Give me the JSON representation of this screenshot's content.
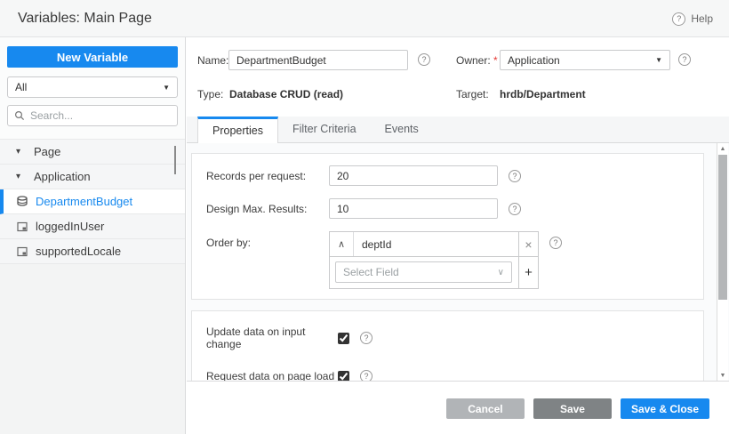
{
  "header": {
    "title": "Variables: Main Page",
    "help_label": "Help"
  },
  "sidebar": {
    "new_variable_label": "New Variable",
    "filter_value": "All",
    "search_placeholder": "Search...",
    "tree": [
      {
        "label": "Page",
        "type": "group",
        "expanded": true
      },
      {
        "label": "Application",
        "type": "group",
        "expanded": true
      },
      {
        "label": "DepartmentBudget",
        "type": "variable",
        "icon": "database-crud-variable-icon",
        "selected": true
      },
      {
        "label": "loggedInUser",
        "type": "variable",
        "icon": "static-variable-icon",
        "selected": false
      },
      {
        "label": "supportedLocale",
        "type": "variable",
        "icon": "static-variable-icon",
        "selected": false
      }
    ]
  },
  "form": {
    "name_label": "Name:",
    "name_value": "DepartmentBudget",
    "owner_label": "Owner:",
    "owner_value": "Application",
    "type_label": "Type:",
    "type_value": "Database CRUD (read)",
    "target_label": "Target:",
    "target_value": "hrdb/Department",
    "required_marker": "*"
  },
  "tabs": [
    {
      "label": "Properties",
      "active": true
    },
    {
      "label": "Filter Criteria",
      "active": false
    },
    {
      "label": "Events",
      "active": false
    }
  ],
  "properties": {
    "records_label": "Records per request:",
    "records_value": "20",
    "design_max_label": "Design Max. Results:",
    "design_max_value": "10",
    "order_by_label": "Order by:",
    "order_by_field": "deptId",
    "select_field_placeholder": "Select Field",
    "update_data_label": "Update data on input change",
    "update_data_checked": true,
    "request_data_label": "Request data on page load",
    "request_data_checked": true
  },
  "footer": {
    "cancel_label": "Cancel",
    "save_label": "Save",
    "save_close_label": "Save & Close"
  },
  "icons": {
    "question_mark": "?",
    "caret_down": "▼",
    "tree_caret": "▾",
    "chevron_up": "∧",
    "chevron_down": "∨",
    "remove": "×",
    "add": "+",
    "scroll_up": "▲",
    "scroll_down": "▼"
  },
  "colors": {
    "accent_blue": "#1789ef",
    "save_gray": "#7f8385",
    "cancel_gray": "#b1b4b7",
    "required_red": "#e53935"
  }
}
